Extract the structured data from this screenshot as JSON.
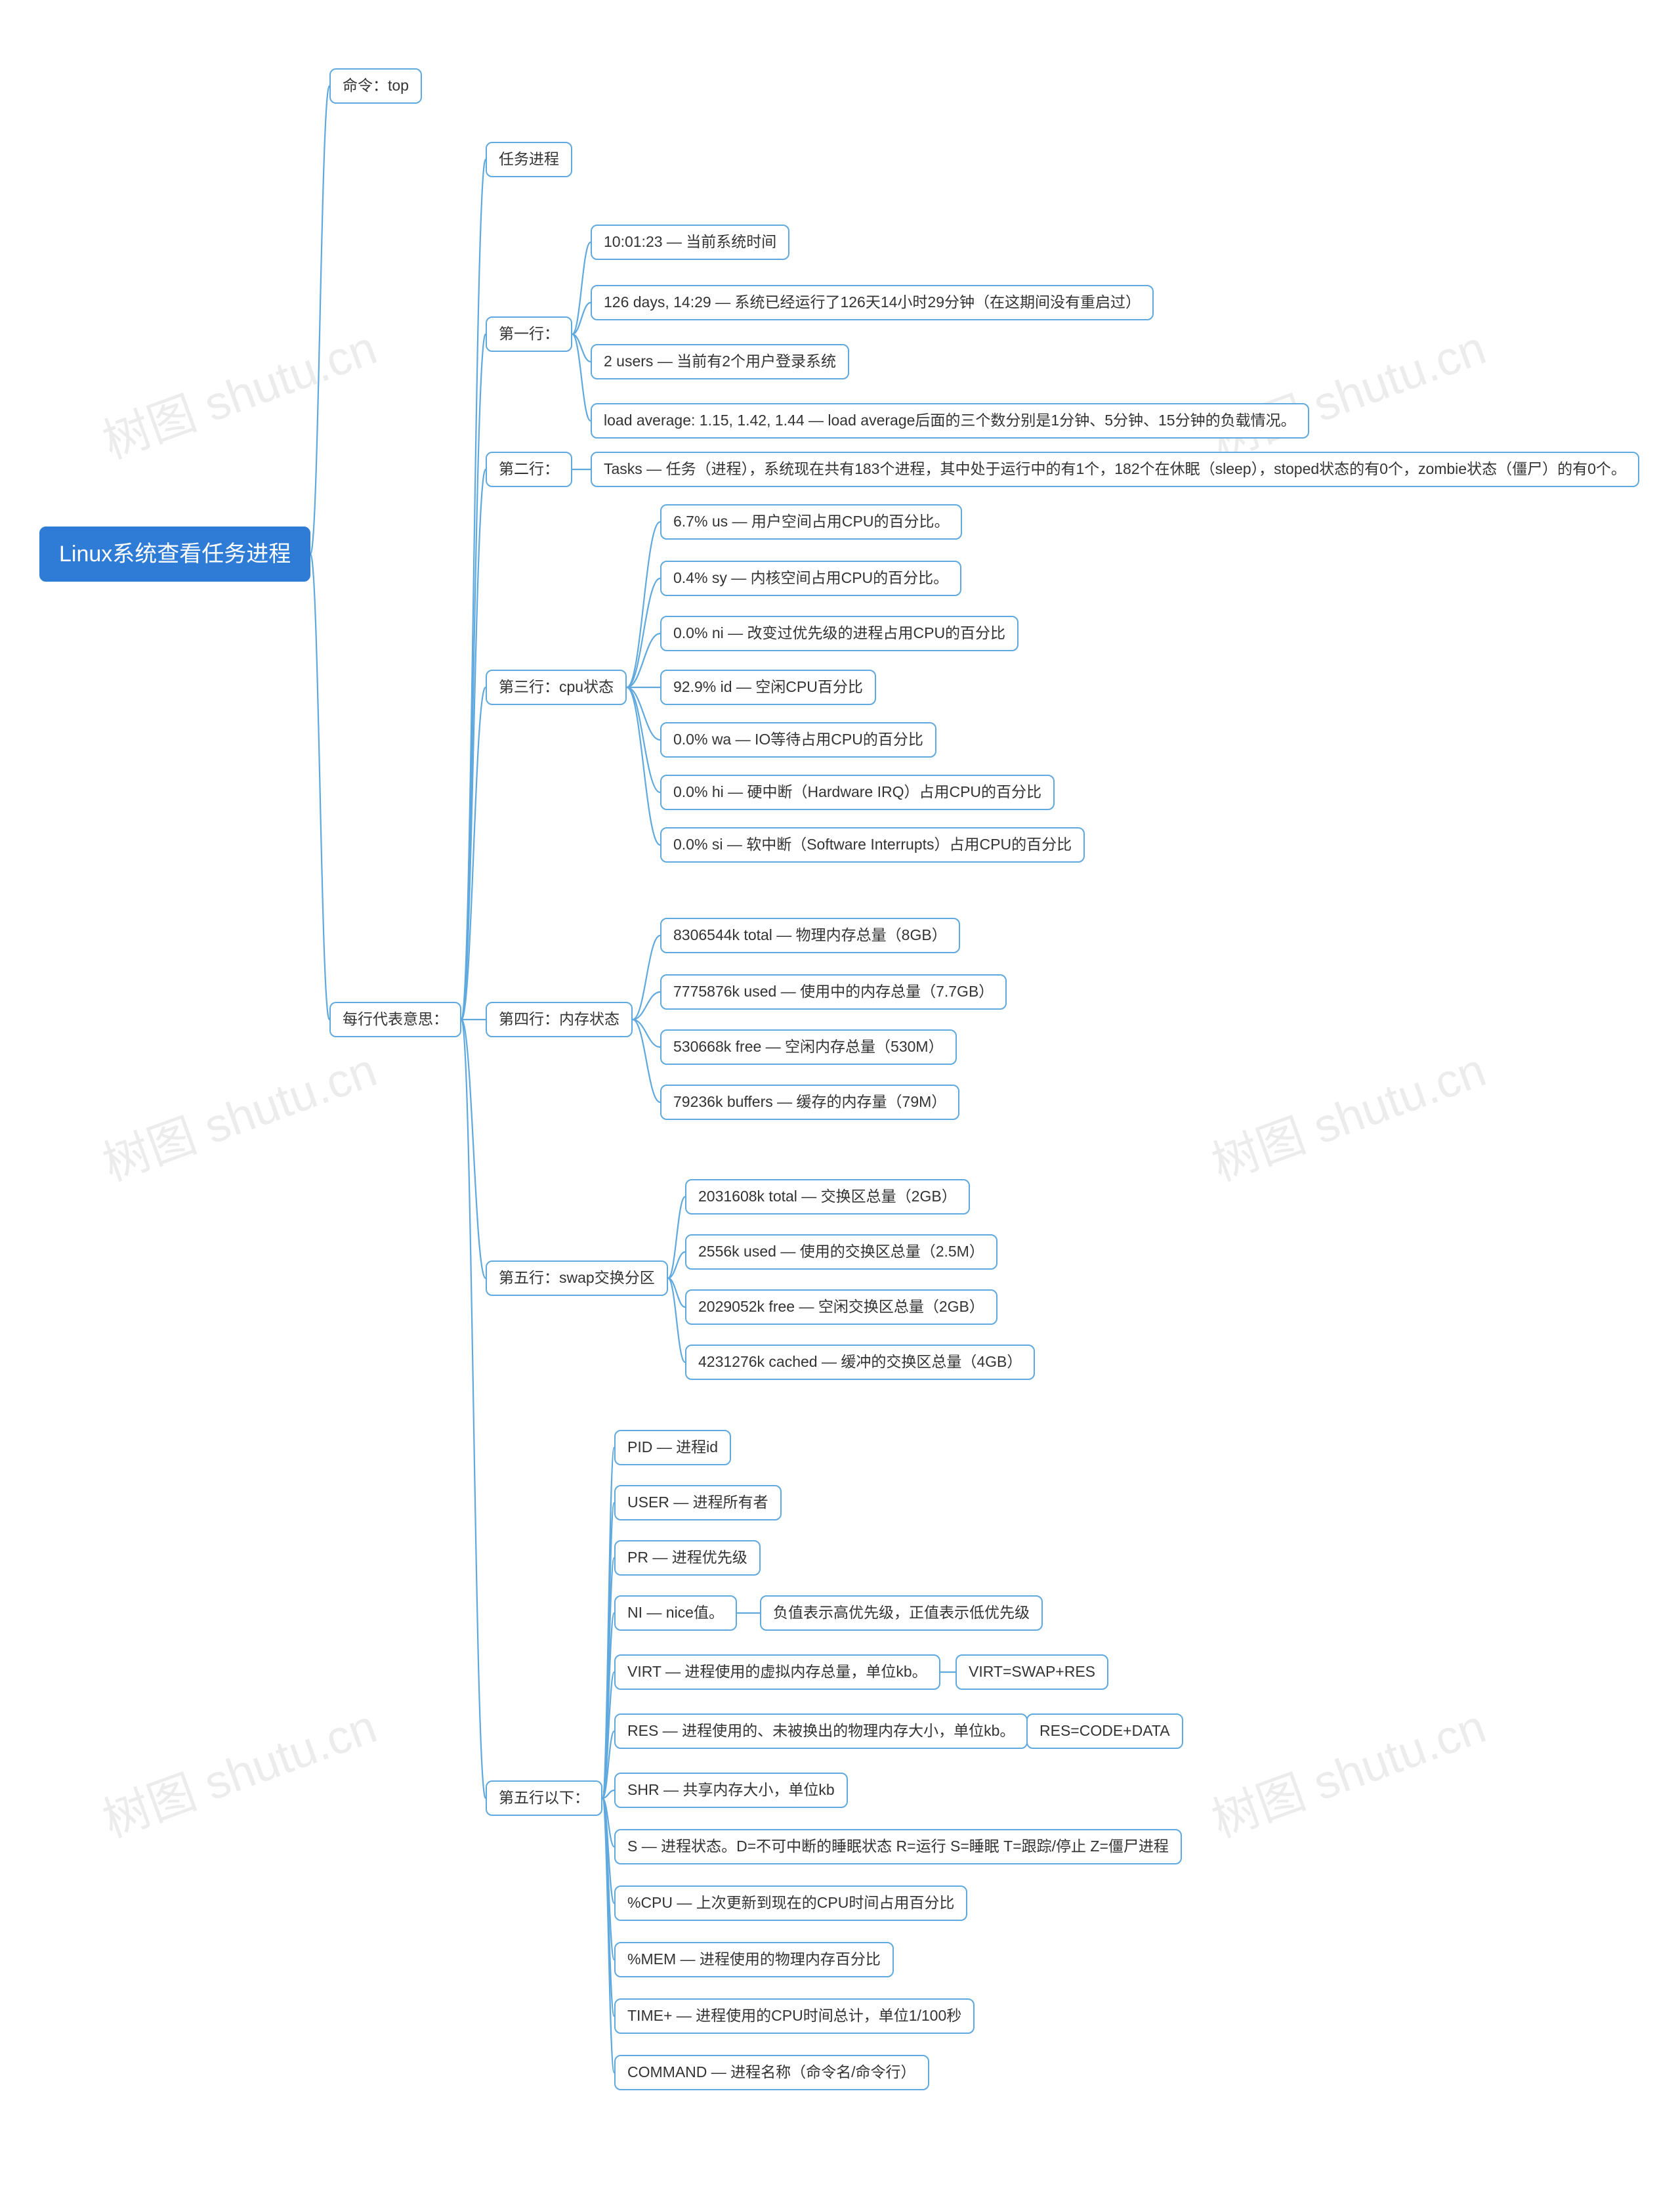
{
  "watermark": "树图 shutu.cn",
  "root": "Linux系统查看任务进程",
  "cmd": {
    "label": "命令：top"
  },
  "meaning": {
    "label": "每行代表意思：",
    "tasks": "任务进程",
    "row1": {
      "label": "第一行：",
      "items": {
        "time": "10:01:23 — 当前系统时间",
        "uptime": "126 days, 14:29 — 系统已经运行了126天14小时29分钟（在这期间没有重启过）",
        "users": "2 users — 当前有2个用户登录系统",
        "load": "load average: 1.15, 1.42, 1.44 — load average后面的三个数分别是1分钟、5分钟、15分钟的负载情况。"
      }
    },
    "row2": {
      "label": "第二行：",
      "tasks": "Tasks — 任务（进程），系统现在共有183个进程，其中处于运行中的有1个，182个在休眠（sleep），stoped状态的有0个，zombie状态（僵尸）的有0个。"
    },
    "row3": {
      "label": "第三行：cpu状态",
      "items": {
        "us": "6.7% us — 用户空间占用CPU的百分比。",
        "sy": "0.4% sy — 内核空间占用CPU的百分比。",
        "ni": "0.0% ni — 改变过优先级的进程占用CPU的百分比",
        "id": "92.9% id — 空闲CPU百分比",
        "wa": "0.0% wa — IO等待占用CPU的百分比",
        "hi": "0.0% hi — 硬中断（Hardware IRQ）占用CPU的百分比",
        "si": "0.0% si — 软中断（Software Interrupts）占用CPU的百分比"
      }
    },
    "row4": {
      "label": "第四行：内存状态",
      "items": {
        "total": "8306544k total — 物理内存总量（8GB）",
        "used": "7775876k used — 使用中的内存总量（7.7GB）",
        "free": "530668k free — 空闲内存总量（530M）",
        "buffers": "79236k buffers — 缓存的内存量（79M）"
      }
    },
    "row5": {
      "label": "第五行：swap交换分区",
      "items": {
        "total": "2031608k total — 交换区总量（2GB）",
        "used": "2556k used — 使用的交换区总量（2.5M）",
        "free": "2029052k free — 空闲交换区总量（2GB）",
        "cached": "4231276k cached — 缓冲的交换区总量（4GB）"
      }
    },
    "row6": {
      "label": "第五行以下：",
      "items": {
        "pid": "PID — 进程id",
        "user": "USER — 进程所有者",
        "pr": "PR — 进程优先级",
        "ni": "NI — nice值。",
        "ni_note": "负值表示高优先级，正值表示低优先级",
        "virt": "VIRT — 进程使用的虚拟内存总量，单位kb。",
        "virt_note": "VIRT=SWAP+RES",
        "res": "RES — 进程使用的、未被换出的物理内存大小，单位kb。",
        "res_note": "RES=CODE+DATA",
        "shr": "SHR — 共享内存大小，单位kb",
        "s": "S — 进程状态。D=不可中断的睡眠状态 R=运行 S=睡眠 T=跟踪/停止 Z=僵尸进程",
        "cpu": "%CPU — 上次更新到现在的CPU时间占用百分比",
        "mem": "%MEM — 进程使用的物理内存百分比",
        "time": "TIME+ — 进程使用的CPU时间总计，单位1/100秒",
        "command": "COMMAND — 进程名称（命令名/命令行）"
      }
    }
  }
}
